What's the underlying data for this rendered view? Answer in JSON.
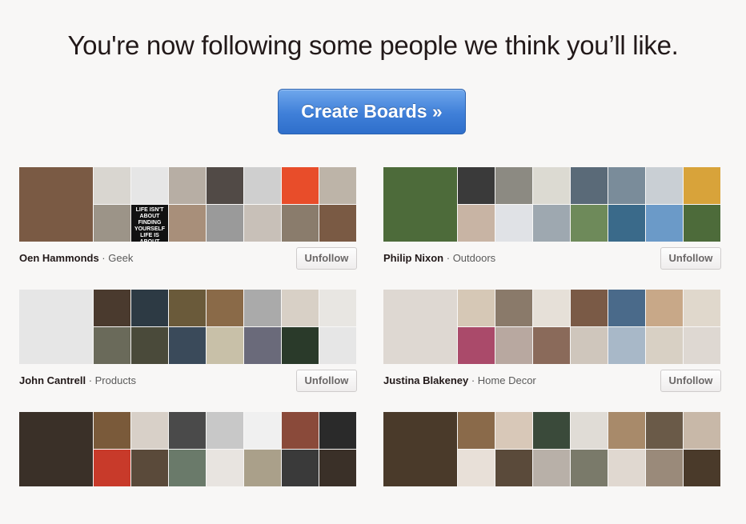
{
  "headline": "You're now following some people we think you’ll like.",
  "cta_label": "Create Boards »",
  "unfollow_label": "Unfollow",
  "separator": "·",
  "people": [
    {
      "name": "Oen Hammonds",
      "category": "Geek",
      "tile_text": "LIFE ISN'T ABOUT FINDING YOURSELF LIFE IS ABOUT CREATING YOURSELF.",
      "colors": [
        "#7a5a44",
        "#d9d6d0",
        "#e6e6e6",
        "#b7aea4",
        "#514a46",
        "#cfcfcf",
        "#e84d2a",
        "#bdb4a8",
        "#9c9488",
        "#2a2a2a",
        "#a88f7a",
        "#9a9a9a",
        "#c8c0b8",
        "#8a7c6c"
      ]
    },
    {
      "name": "Philip Nixon",
      "category": "Outdoors",
      "tile_text": "",
      "colors": [
        "#4d6b3a",
        "#3a3a3a",
        "#8c8a82",
        "#dcdad2",
        "#5a6a78",
        "#7a8c9a",
        "#c9cfd4",
        "#d8a33a",
        "#c8b4a4",
        "#e0e2e6",
        "#9ea8b0",
        "#6e8a5a",
        "#3a6a8a",
        "#6b9ac8"
      ]
    },
    {
      "name": "John Cantrell",
      "category": "Products",
      "tile_text": "",
      "colors": [
        "#e6e6e6",
        "#4a3a2e",
        "#2d3a44",
        "#6a5a3a",
        "#8a6a48",
        "#aaaaaa",
        "#d8d0c6",
        "#e8e6e2",
        "#6a6a5a",
        "#4a4a3a",
        "#3a4a5a",
        "#c8c0a8",
        "#6a6a7a",
        "#2a3a2a"
      ]
    },
    {
      "name": "Justina Blakeney",
      "category": "Home Decor",
      "tile_text": "",
      "colors": [
        "#ded8d2",
        "#d6c8b6",
        "#8a7a6a",
        "#e6e0d8",
        "#7a5a46",
        "#4a6a8a",
        "#c8a888",
        "#e0d8cc",
        "#aa4a6a",
        "#b8a8a0",
        "#8a6a5a",
        "#cfc6bc",
        "#a8b8c8",
        "#d8d0c4"
      ]
    },
    {
      "name": "",
      "category": "",
      "tile_text": "",
      "colors": [
        "#3a3028",
        "#7a5a3a",
        "#d8d0c8",
        "#4a4a4a",
        "#c8c8c8",
        "#f0f0f0",
        "#8a4a3a",
        "#2a2a2a",
        "#c83a2a",
        "#5a4a3a",
        "#6a7a6a",
        "#e8e4e0",
        "#aaa08a",
        "#3a3a3a"
      ]
    },
    {
      "name": "",
      "category": "",
      "tile_text": "",
      "colors": [
        "#4a3a2a",
        "#8a6a4a",
        "#d8c8b8",
        "#3a4a3a",
        "#e0dcd6",
        "#a88a6a",
        "#6a5a48",
        "#c8b8a8",
        "#e8e0d8",
        "#5a4a3a",
        "#b8b0a8",
        "#7a7a6a",
        "#e0d8d0",
        "#9a8a7a"
      ]
    }
  ]
}
